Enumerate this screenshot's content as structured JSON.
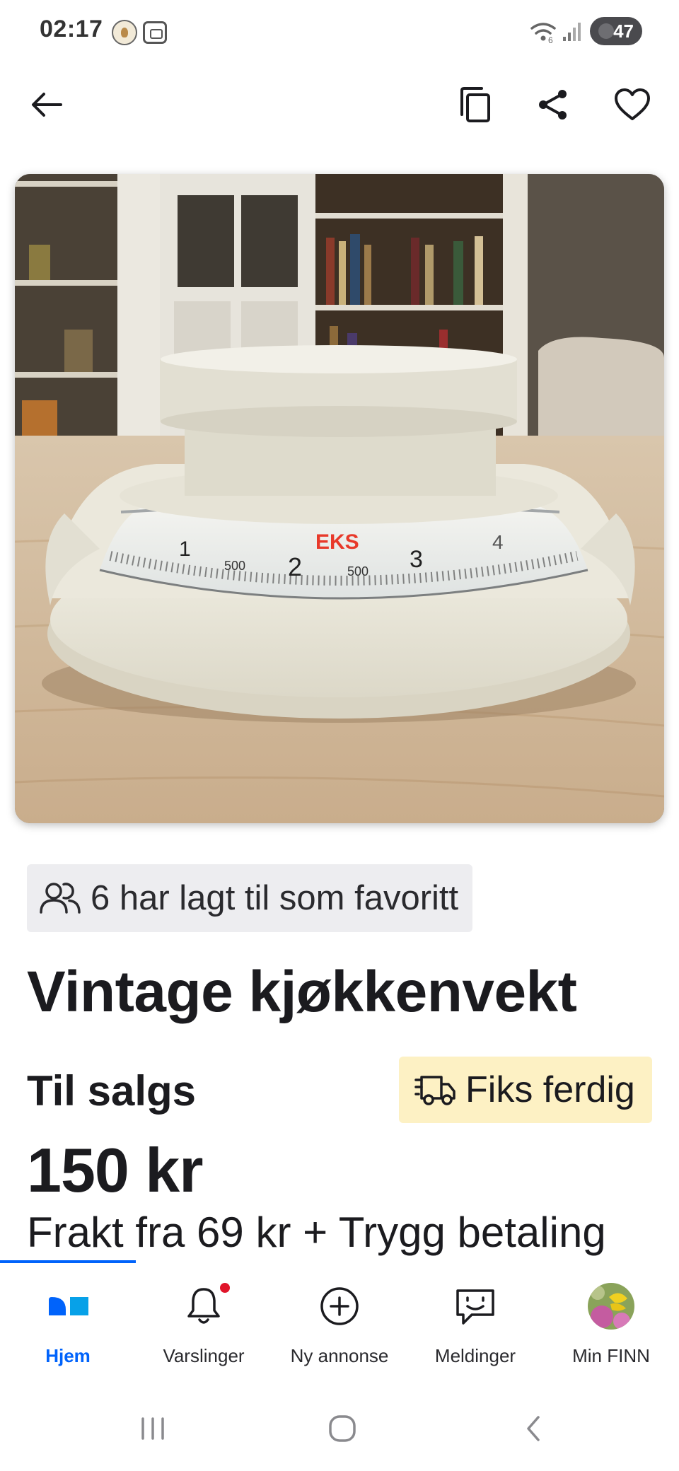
{
  "status_bar": {
    "time": "02:17",
    "battery": "47",
    "icons": [
      "flower-app-icon",
      "screenshot-icon",
      "wifi-icon",
      "signal-icon",
      "battery-icon"
    ]
  },
  "header": {
    "icons": [
      "back-arrow-icon",
      "copy-icon",
      "share-icon",
      "heart-icon"
    ]
  },
  "listing": {
    "favorites_text": "6 har lagt til som favoritt",
    "title": "Vintage kjøkkenvekt",
    "sale_type": "Til salgs",
    "fiks_ferdig": "Fiks ferdig",
    "price": "150 kr",
    "shipping": "Frakt fra 69 kr + Trygg betaling",
    "photo": {
      "brand_text": "EKS",
      "dial_numbers": [
        "1",
        "500",
        "2",
        "500",
        "3",
        "4"
      ]
    }
  },
  "bottom_nav": {
    "items": [
      {
        "label": "Hjem",
        "icon": "home-icon",
        "active": true
      },
      {
        "label": "Varslinger",
        "icon": "bell-icon",
        "active": false
      },
      {
        "label": "Ny annonse",
        "icon": "plus-circle-icon",
        "active": false
      },
      {
        "label": "Meldinger",
        "icon": "chat-icon",
        "active": false
      },
      {
        "label": "Min FINN",
        "icon": "avatar",
        "active": false
      }
    ]
  },
  "colors": {
    "accent": "#0063fb",
    "notification": "#e0152a",
    "fiks_badge_bg": "#fdf1c4",
    "fav_badge_bg": "#ededf0"
  }
}
